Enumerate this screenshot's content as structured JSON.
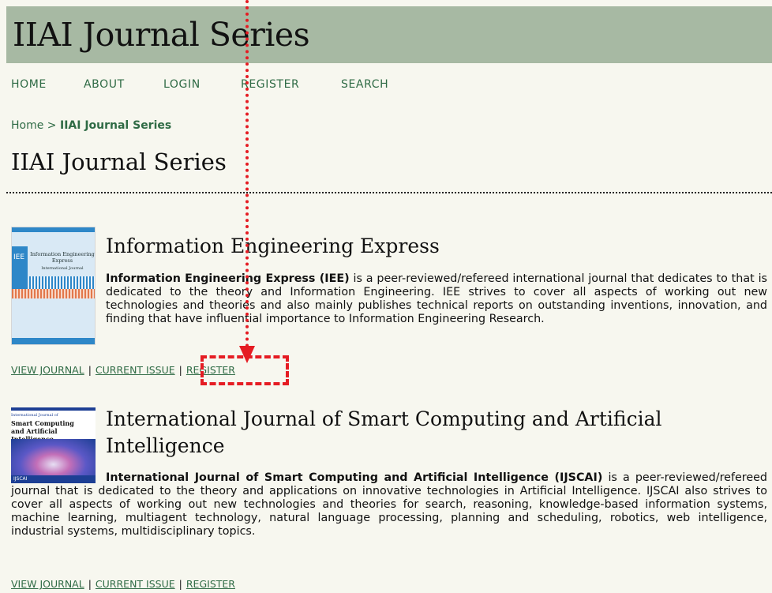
{
  "site": {
    "title": "IIAI Journal Series"
  },
  "nav": [
    "HOME",
    "ABOUT",
    "LOGIN",
    "REGISTER",
    "SEARCH"
  ],
  "breadcrumb": {
    "home": "Home",
    "separator": ">",
    "current": "IIAI Journal Series"
  },
  "page_title": "IIAI Journal Series",
  "journals": [
    {
      "title": "Information Engineering Express",
      "description_bold": "Information Engineering Express (IEE)",
      "description_rest": " is a peer-reviewed/refereed international journal that dedicates to that is dedicated to the theory and Information Engineering. IEE strives to cover all aspects of working out new technologies and theories and also mainly publishes technical reports on outstanding inventions, innovation, and finding that have influential importance to Information Engineering Research.",
      "links": [
        "VIEW JOURNAL",
        "CURRENT ISSUE",
        "REGISTER"
      ],
      "cover": {
        "abbr": "IEE",
        "title_line1": "Information Engineering",
        "title_line2": "Express",
        "subtitle": "International Journal",
        "colors": [
          "#2e87c8",
          "#e2784c"
        ]
      }
    },
    {
      "title": "International Journal of Smart Computing and Artificial Intelligence",
      "description_bold": "International Journal of Smart Computing and Artificial Intelligence (IJSCAI)",
      "description_rest": " is a peer-reviewed/refereed journal that is dedicated to the theory and applications on innovative technologies in Artificial Intelligence. IJSCAI also strives to cover all aspects of working out new technologies and theories for search, reasoning, knowledge-based information systems, machine learning, multiagent technology, natural language processing, planning and scheduling, robotics, web intelligence, industrial systems, multidisciplinary topics.",
      "links": [
        "VIEW JOURNAL",
        "CURRENT ISSUE",
        "REGISTER"
      ],
      "cover": {
        "abbr": "IJSCAI",
        "title_line1": "Smart Computing",
        "title_line2": "and Artificial Intelligence",
        "label_small": "International Journal of",
        "colors": [
          "#1d3f94",
          "#c36fb8"
        ]
      }
    }
  ],
  "annotation": {
    "color": "#e51c23",
    "target": "REGISTER"
  },
  "theme": {
    "header_bg": "#a7b9a3",
    "link": "#2f6b45",
    "page_bg": "#f7f7ef"
  }
}
